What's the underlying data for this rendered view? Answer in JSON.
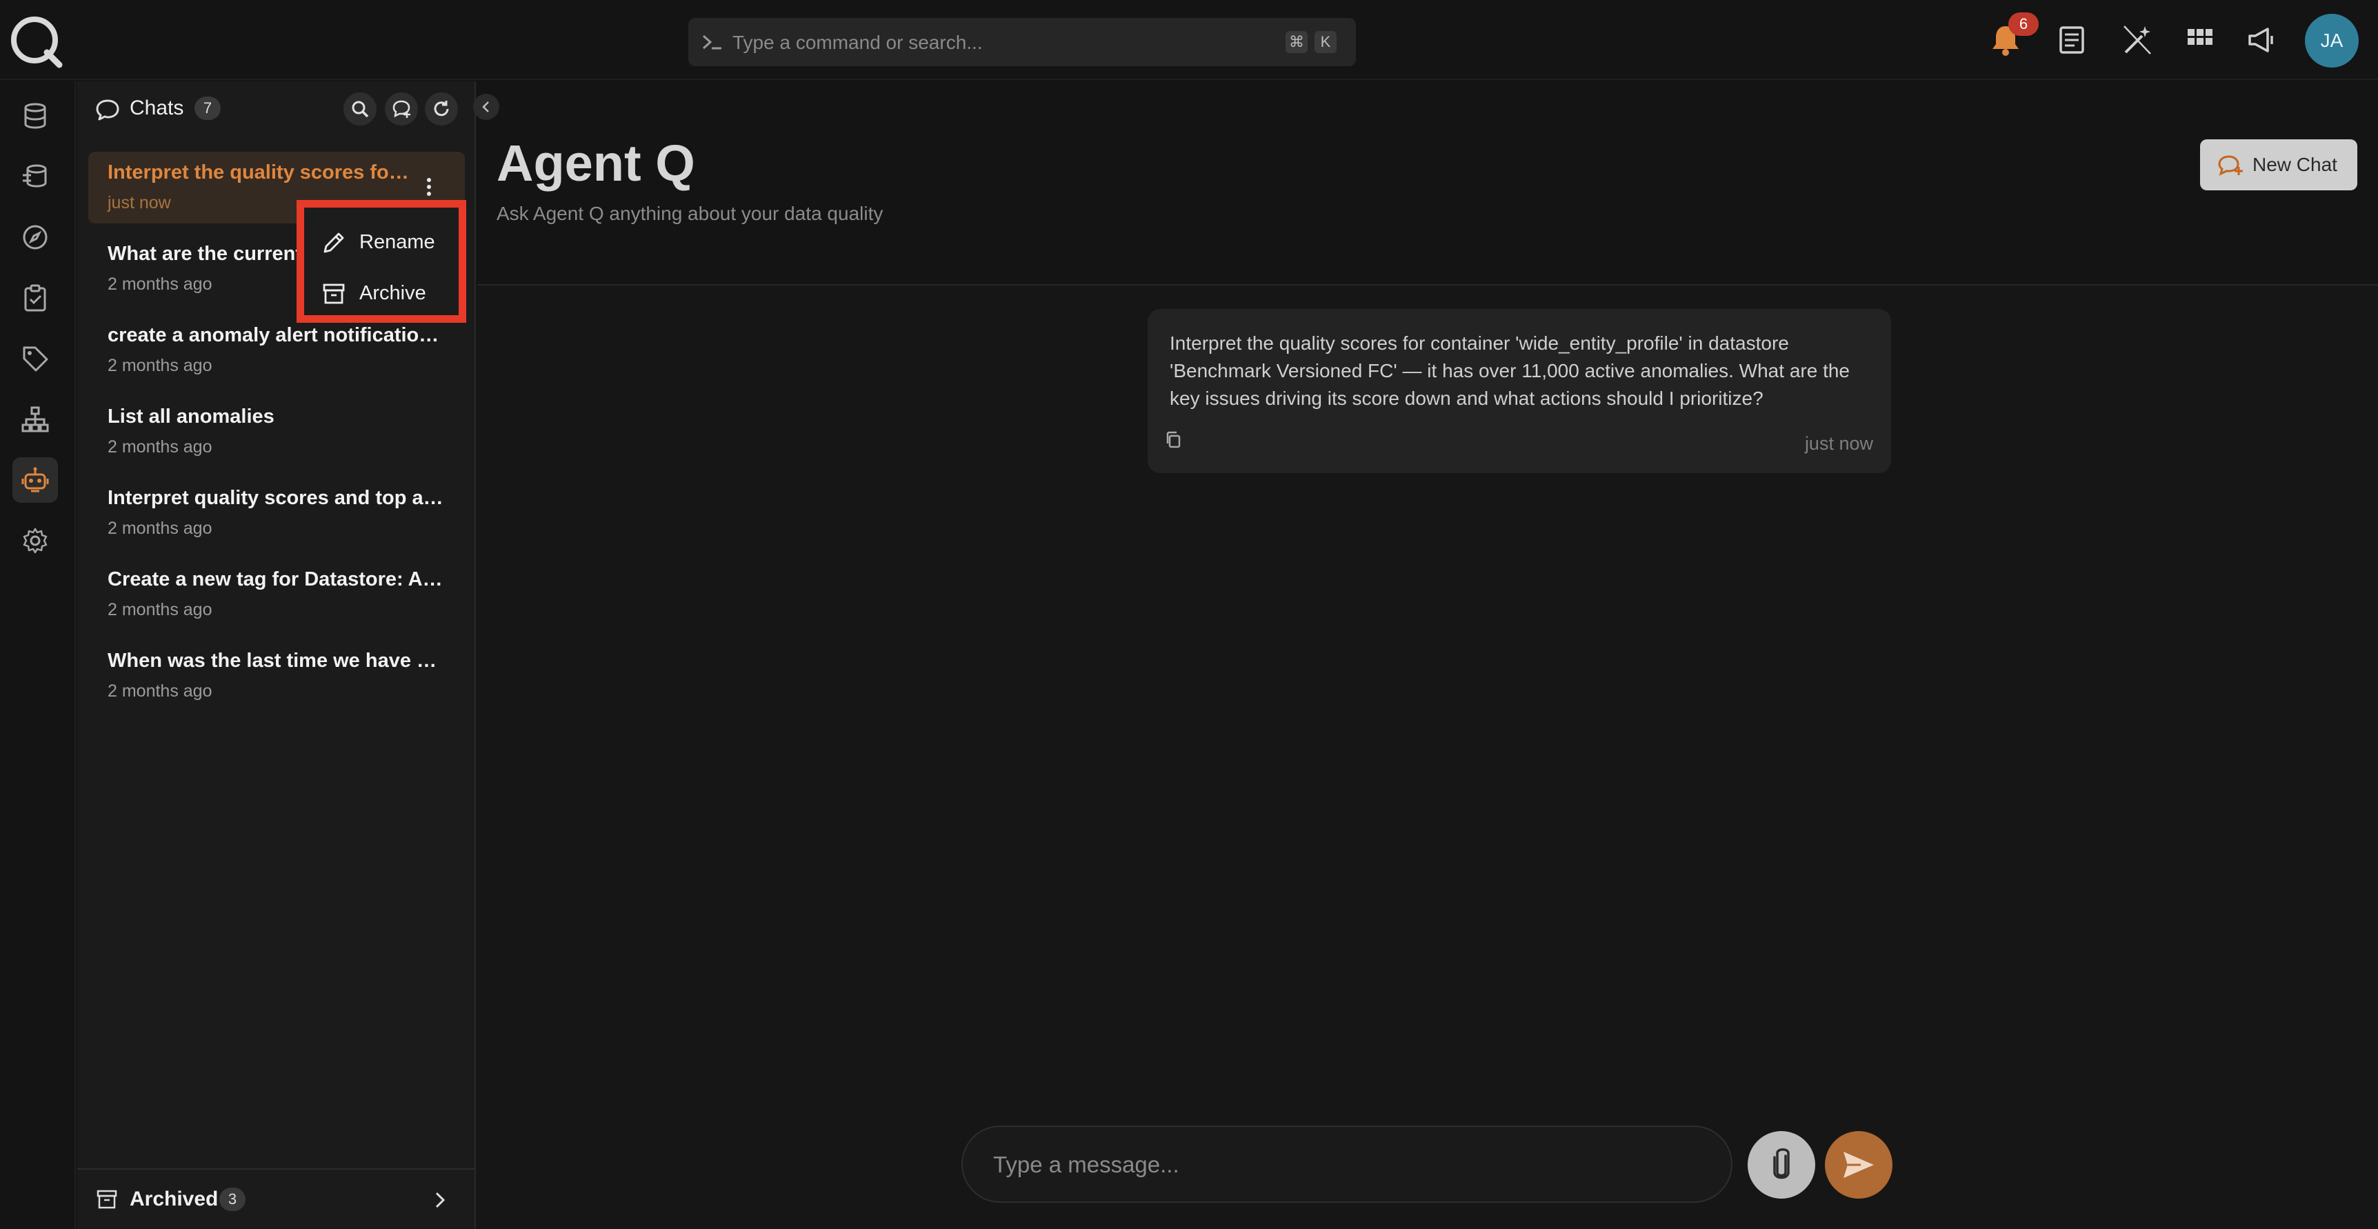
{
  "topbar": {
    "search_placeholder": "Type a command or search...",
    "shortcut_keys": [
      "⌘",
      "K"
    ],
    "notifications_count": "6",
    "avatar_initials": "JA",
    "icons": [
      "bell-icon",
      "document-icon",
      "magic-wand-icon",
      "grid-icon",
      "megaphone-icon"
    ]
  },
  "rail": {
    "items": [
      "database-icon",
      "datastore-stack-icon",
      "compass-icon",
      "clipboard-check-icon",
      "tag-icon",
      "hierarchy-icon",
      "robot-icon",
      "gear-icon"
    ],
    "active": "robot-icon"
  },
  "chats": {
    "title": "Chats",
    "count": "7",
    "items": [
      {
        "title": "Interpret the quality scores for container 'wide_entity_profile'",
        "time": "just now"
      },
      {
        "title": "What are the current open anomalies",
        "time": "2 months ago"
      },
      {
        "title": "create a anomaly alert notification for slack",
        "time": "2 months ago"
      },
      {
        "title": "List all anomalies",
        "time": "2 months ago"
      },
      {
        "title": "Interpret quality scores and top anomalies",
        "time": "2 months ago"
      },
      {
        "title": "Create a new tag for Datastore: Analytics",
        "time": "2 months ago"
      },
      {
        "title": "When was the last time we have an anomaly",
        "time": "2 months ago"
      }
    ],
    "archived_label": "Archived",
    "archived_count": "3"
  },
  "context_menu": {
    "rename": "Rename",
    "archive": "Archive",
    "highlight_color": "#e83a28"
  },
  "main": {
    "title": "Agent Q",
    "subtitle": "Ask Agent Q anything about your data quality",
    "new_chat_label": "New Chat",
    "message": {
      "text": "Interpret the quality scores for container 'wide_entity_profile' in datastore 'Benchmark Versioned FC' — it has over 11,000 active anomalies. What are the key issues driving its score down and what actions should I prioritize?",
      "time": "just now"
    },
    "composer_placeholder": "Type a message..."
  },
  "colors": {
    "accent": "#e0873e",
    "send_button": "#b06a33",
    "avatar": "#2f7f9a",
    "badge": "#c0392b"
  }
}
